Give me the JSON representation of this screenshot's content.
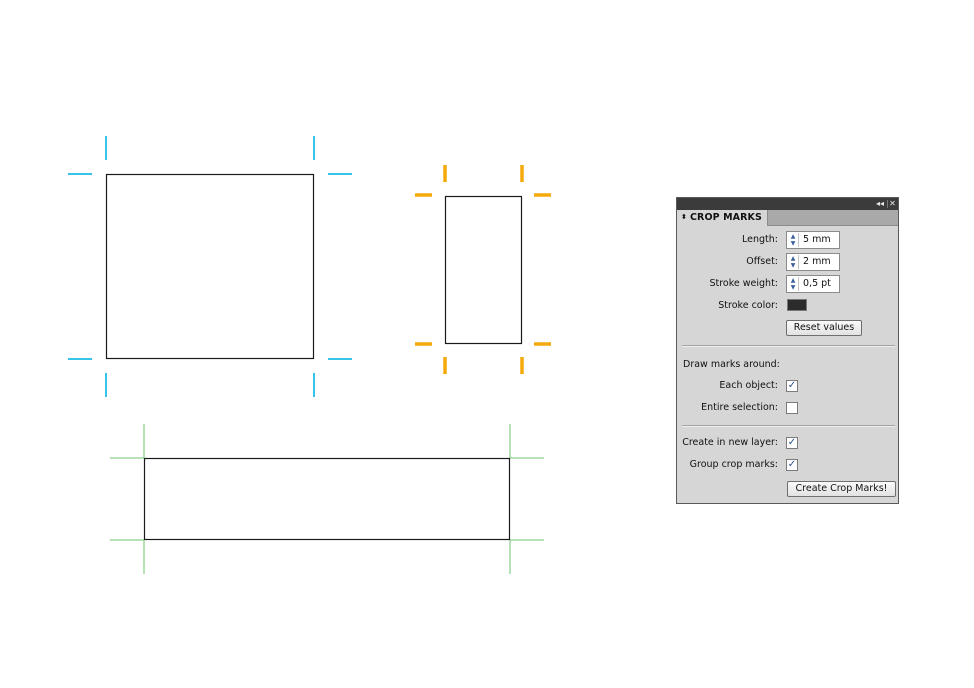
{
  "canvas": {
    "colors": {
      "cyan_marks": "#36c5e8",
      "orange_marks": "#f5a90a",
      "green_marks": "#6fc56f",
      "shape_stroke": "#1a1a1a"
    }
  },
  "panel": {
    "titlebar": {
      "collapse_icon": "double-chevron-left-icon",
      "collapse_glyph": "◂◂",
      "close_icon": "close-icon",
      "close_glyph": "✕"
    },
    "tab": {
      "arrows_glyph": "⬍",
      "title": "CROP MARKS"
    },
    "fields": {
      "length": {
        "label": "Length:",
        "value": "5 mm"
      },
      "offset": {
        "label": "Offset:",
        "value": "2 mm"
      },
      "stroke_weight": {
        "label": "Stroke weight:",
        "value": "0,5 pt"
      },
      "stroke_color": {
        "label": "Stroke color:",
        "color": "#2b2b2b"
      }
    },
    "spinner_glyph": "▲\n▼",
    "reset_button": "Reset values",
    "draw_marks_label": "Draw marks around:",
    "options": {
      "each_object": {
        "label": "Each object:",
        "checked": true
      },
      "entire_selection": {
        "label": "Entire selection:",
        "checked": false
      },
      "create_in_new_layer": {
        "label": "Create in new layer:",
        "checked": true
      },
      "group_crop_marks": {
        "label": "Group crop marks:",
        "checked": true
      }
    },
    "check_glyph": "✓",
    "create_button": "Create Crop Marks!"
  }
}
